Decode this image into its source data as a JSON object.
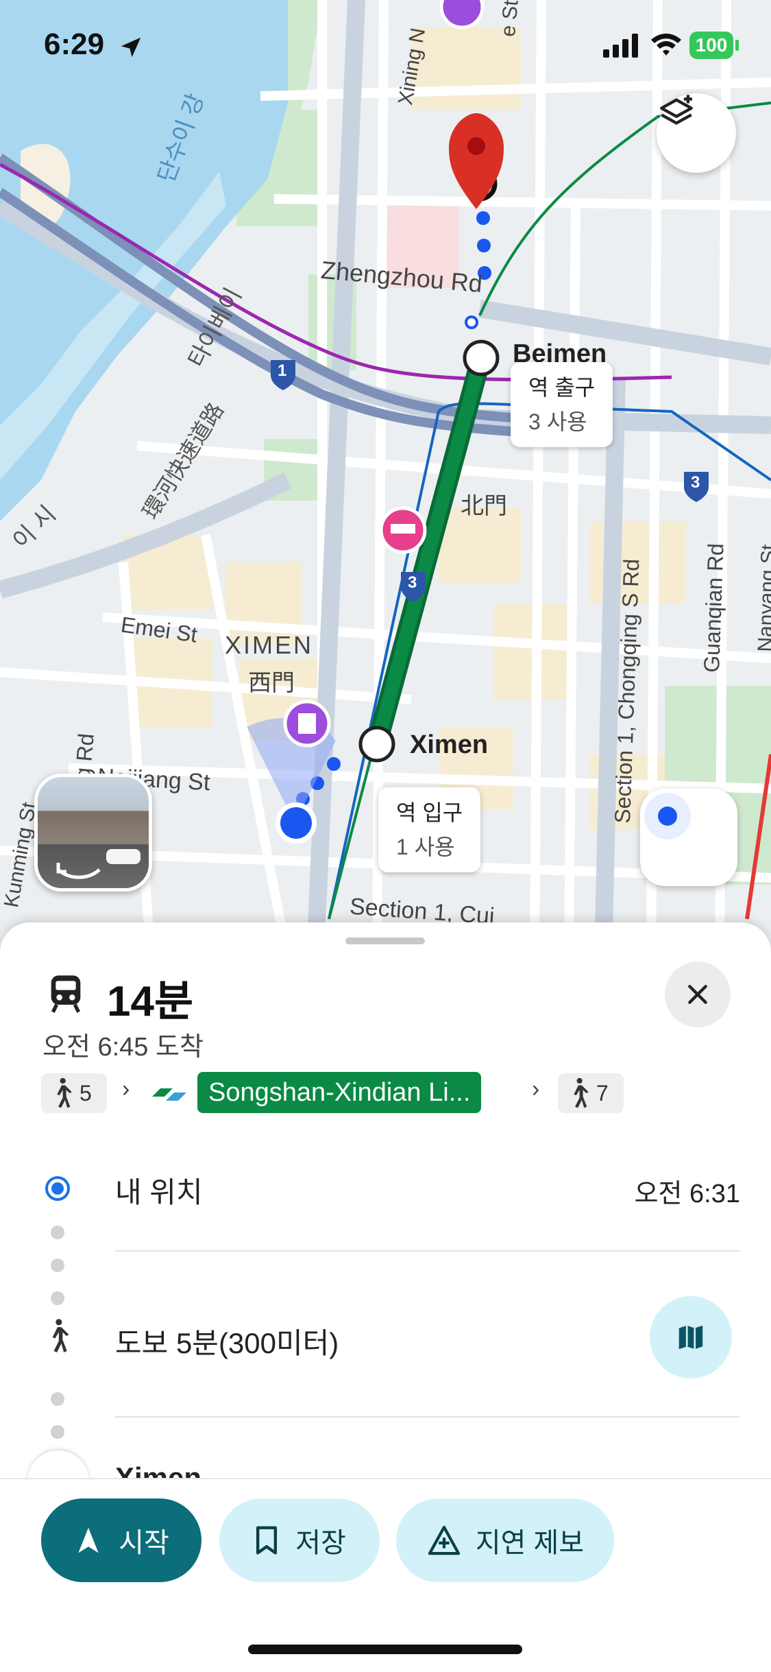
{
  "status_bar": {
    "time": "6:29",
    "battery": "100"
  },
  "map": {
    "labels": {
      "river_ko": "단수이 강",
      "expressway_ko": "타이베이",
      "expressway_zh": "環河快速道路",
      "city_fragment": "이 시",
      "xining": "Xining N",
      "st_fragment": "e St",
      "zhengzhou": "Zhengzhou Rd",
      "beimen": "Beimen",
      "beimen_zh": "北門",
      "emei": "Emei St",
      "ximen_district": "XIMEN",
      "ximen_district_zh": "西門",
      "ximen_station": "Ximen",
      "neijiang": "Neijiang St",
      "kang_rd": "ing Rd",
      "chongqing": "Section 1, Chongqing S Rd",
      "guanqian": "Guanqian Rd",
      "nanyang": "Nanyang St",
      "section1": "Section 1, Cui",
      "kunming": "Kunming St",
      "shield_1": "1",
      "shield_3a": "3",
      "shield_3b": "3"
    },
    "exit_callout": {
      "title": "역 출구",
      "sub": "3 사용"
    },
    "entrance_callout": {
      "title": "역 입구",
      "sub": "1 사용"
    }
  },
  "trip": {
    "duration": "14분",
    "arrival": "오전 6:45 도착",
    "walk1_minutes": "5",
    "line_name": "Songshan-Xindian Li...",
    "walk2_minutes": "7",
    "line_color": "#0a8a45"
  },
  "steps": {
    "my_location": "내 위치",
    "depart_time": "오전 6:31",
    "walk_text": "도보 5분(300미터)",
    "next_station": "Ximen"
  },
  "actions": {
    "start": "시작",
    "save": "저장",
    "report": "지연 제보"
  },
  "colors": {
    "accent": "#0b6e7a",
    "button_light": "#d3f1f8",
    "location_blue": "#1a73e8",
    "pin_red": "#d93025"
  }
}
